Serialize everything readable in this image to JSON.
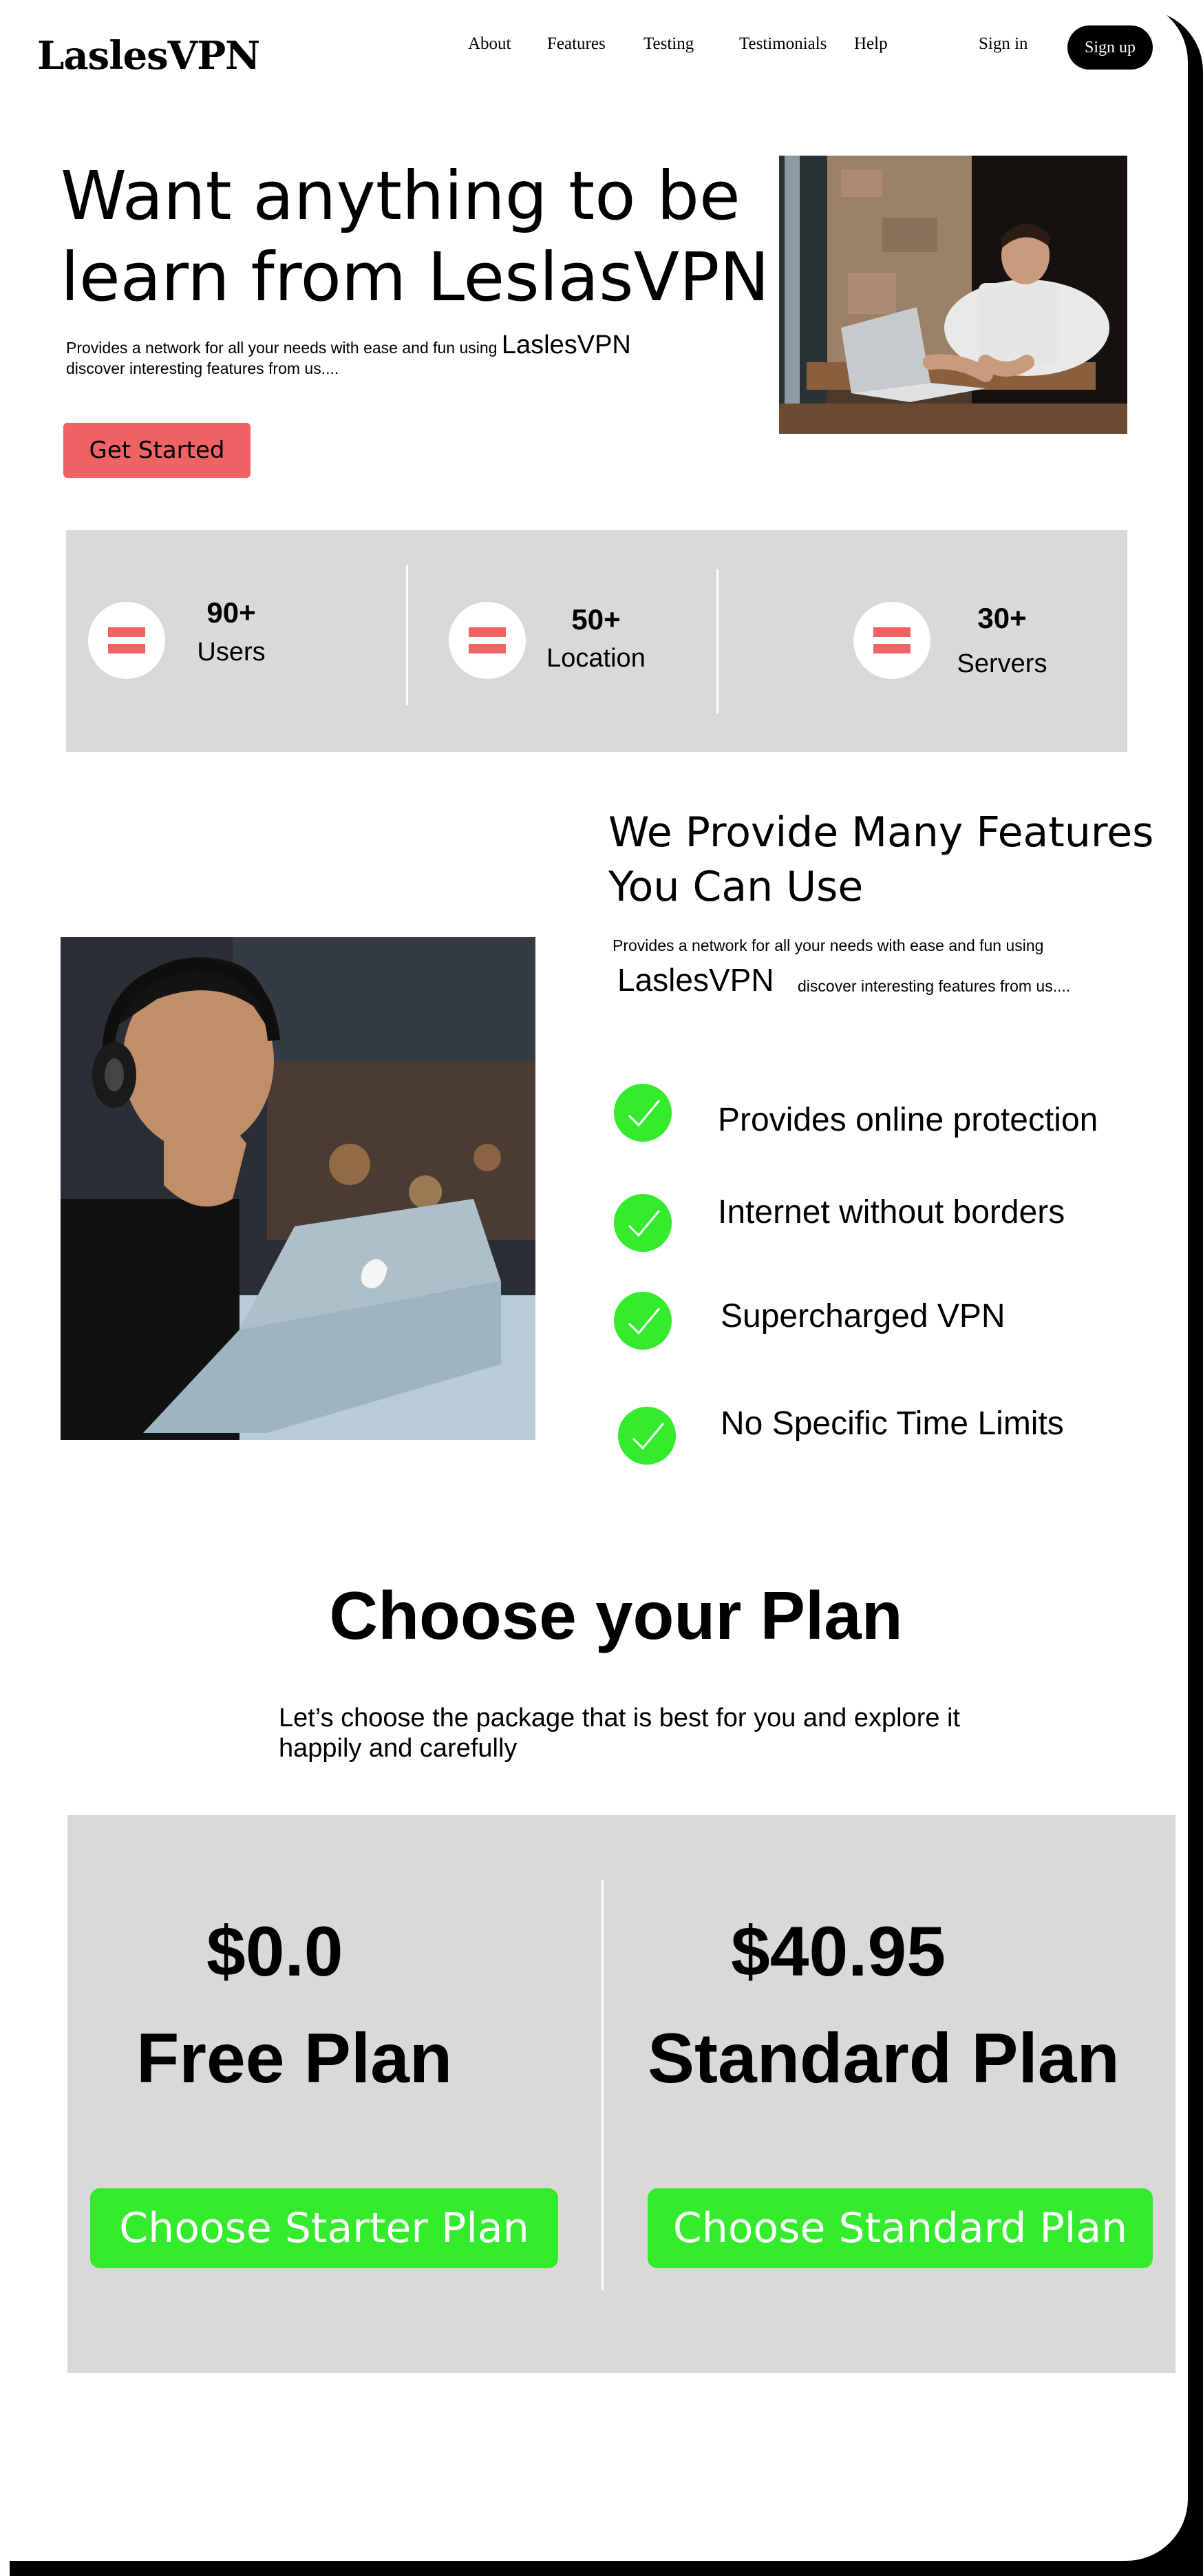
{
  "nav": {
    "logo": "LaslesVPN",
    "links": [
      "About",
      "Features",
      "Testing",
      "Testimonials",
      "Help"
    ],
    "signin": "Sign in",
    "signup": "Sign up"
  },
  "hero": {
    "title": "Want anything to be learn from LeslasVPN",
    "desc_part1": "Provides a network for all your needs with ease and fun using",
    "desc_brand": "LaslesVPN",
    "desc_part2": "discover interesting features from us....",
    "cta": "Get Started"
  },
  "stats": [
    {
      "value": "90+",
      "label": "Users"
    },
    {
      "value": "50+",
      "label": "Location"
    },
    {
      "value": "30+",
      "label": "Servers"
    }
  ],
  "features": {
    "title": "We Provide Many Features You Can Use",
    "desc_part1": "Provides a network for all your needs with ease and fun using",
    "desc_brand": "LaslesVPN",
    "desc_part2": "discover interesting features from us....",
    "items": [
      "Provides online protection",
      "Internet without borders",
      "Supercharged VPN",
      "No Specific Time Limits"
    ],
    "check_color": "#33ea2c"
  },
  "plans": {
    "heading": "Choose your Plan",
    "subtitle": "Let’s choose the package that is best for you and  explore it happily and carefully",
    "items": [
      {
        "price": "$0.0",
        "name": "Free Plan",
        "button": "Choose Starter Plan"
      },
      {
        "price": "$40.95",
        "name": "Standard Plan",
        "button": "Choose Standard Plan"
      }
    ]
  },
  "colors": {
    "accent_red": "#f06364",
    "accent_green": "#33ea2c",
    "panel_gray": "#d9d9d9"
  }
}
